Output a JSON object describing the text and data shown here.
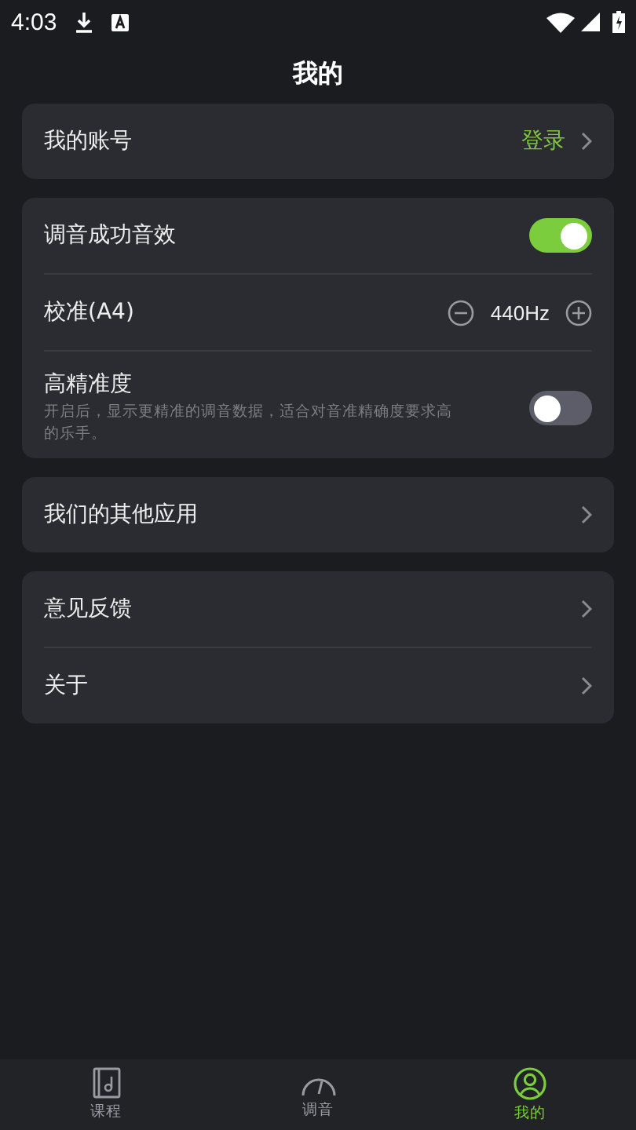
{
  "status_bar": {
    "time": "4:03"
  },
  "title": "我的",
  "sections": [
    {
      "rows": [
        {
          "kind": "link",
          "label": "我的账号",
          "value": "登录"
        }
      ]
    },
    {
      "rows": [
        {
          "kind": "toggle",
          "label": "调音成功音效",
          "on": true
        },
        {
          "kind": "stepper",
          "label": "校准(A4)",
          "value": "440Hz"
        },
        {
          "kind": "toggle",
          "label": "高精准度",
          "description": "开启后，显示更精准的调音数据，适合对音准精确度要求高的乐手。",
          "on": false
        }
      ]
    },
    {
      "rows": [
        {
          "kind": "link",
          "label": "我们的其他应用"
        }
      ]
    },
    {
      "rows": [
        {
          "kind": "link",
          "label": "意见反馈"
        },
        {
          "kind": "link",
          "label": "关于"
        }
      ]
    }
  ],
  "bottom_nav": [
    {
      "kind": "book",
      "label": "课程",
      "selected": false
    },
    {
      "kind": "gauge",
      "label": "调音",
      "selected": false
    },
    {
      "kind": "person",
      "label": "我的",
      "selected": true
    }
  ]
}
